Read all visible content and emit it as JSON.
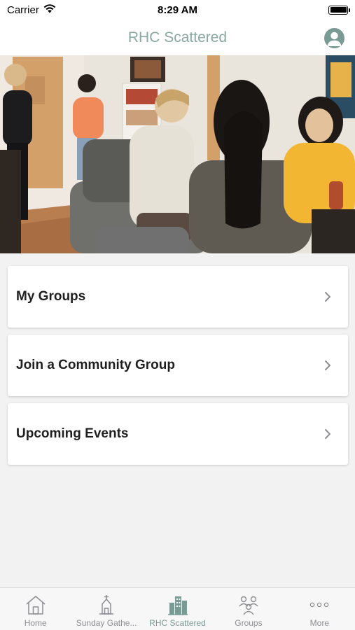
{
  "status_bar": {
    "carrier": "Carrier",
    "time": "8:29 AM"
  },
  "nav": {
    "title": "RHC Scattered",
    "profile_icon": "person-circle-icon"
  },
  "hero": {
    "description_icon": "group-photo"
  },
  "menu": {
    "items": [
      {
        "label": "My Groups"
      },
      {
        "label": "Join a Community Group"
      },
      {
        "label": "Upcoming Events"
      }
    ]
  },
  "tabs": [
    {
      "label": "Home",
      "icon": "house-icon",
      "active": false
    },
    {
      "label": "Sunday Gathe...",
      "icon": "church-icon",
      "active": false
    },
    {
      "label": "RHC Scattered",
      "icon": "buildings-icon",
      "active": true
    },
    {
      "label": "Groups",
      "icon": "people-icon",
      "active": false
    },
    {
      "label": "More",
      "icon": "ellipsis-icon",
      "active": false
    }
  ],
  "colors": {
    "accent": "#7a9a94",
    "title": "#8aa8a2",
    "inactive": "#8e8e93",
    "background": "#f2f2f2"
  }
}
